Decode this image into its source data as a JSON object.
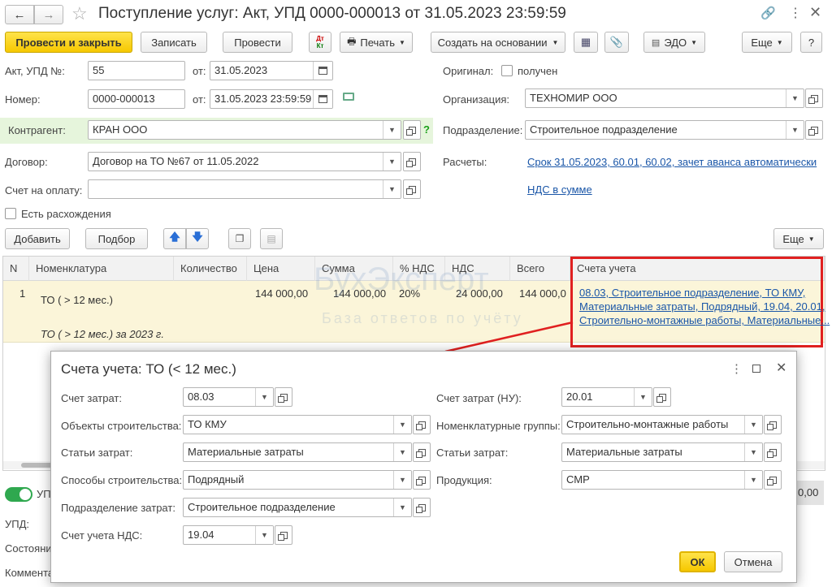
{
  "window": {
    "title": "Поступление услуг: Акт, УПД 0000-000013 от 31.05.2023 23:59:59"
  },
  "toolbar": {
    "post_close": "Провести и закрыть",
    "save": "Записать",
    "post": "Провести",
    "dtkt_top": "Дт",
    "dtkt_bottom": "Кт",
    "print": "Печать",
    "create_based": "Создать на основании",
    "edo": "ЭДО",
    "more": "Еще",
    "help": "?"
  },
  "form": {
    "act_label": "Акт, УПД №:",
    "act_value": "55",
    "from_label": "от:",
    "act_date": "31.05.2023",
    "number_label": "Номер:",
    "number_value": "0000-000013",
    "number_date": "31.05.2023 23:59:59",
    "contractor_label": "Контрагент:",
    "contractor_value": "КРАН ООО",
    "contract_label": "Договор:",
    "contract_value": "Договор на ТО №67 от 11.05.2022",
    "invoice_label": "Счет на оплату:",
    "invoice_value": "",
    "discrepancy_label": "Есть расхождения",
    "original_label": "Оригинал:",
    "received_label": "получен",
    "org_label": "Организация:",
    "org_value": "ТЕХНОМИР ООО",
    "dept_label": "Подразделение:",
    "dept_value": "Строительное подразделение",
    "settlements_label": "Расчеты:",
    "settlements_link": "Срок 31.05.2023, 60.01, 60.02, зачет аванса автоматически",
    "vat_link": "НДС в сумме"
  },
  "table_toolbar": {
    "add": "Добавить",
    "pick": "Подбор",
    "more": "Еще"
  },
  "table": {
    "columns": [
      "N",
      "Номенклатура",
      "Количество",
      "Цена",
      "Сумма",
      "% НДС",
      "НДС",
      "Всего",
      "Счета учета"
    ],
    "row": {
      "n": "1",
      "item": "ТО ( > 12 мес.)",
      "item_sub": "ТО ( > 12 мес.) за 2023 г.",
      "price": "144 000,00",
      "sum": "144 000,00",
      "vat_rate": "20%",
      "vat": "24 000,00",
      "total": "144 000,0",
      "accounts_1": "08.03, Строительное подразделение, ТО КМУ,",
      "accounts_2": "Материальные затраты, Подрядный, 19.04, 20.01,",
      "accounts_3": "Строительно-монтажные работы, Материальные..."
    }
  },
  "bottom": {
    "toggle_label": "УП",
    "upd_label": "УПД:",
    "state_label": "Состояни",
    "comment_label": "Коммента",
    "total_fragment": "0,00"
  },
  "watermark": {
    "brand": "БухЭксперт",
    "tagline": "База ответов по учёту"
  },
  "dialog": {
    "title": "Счета учета: ТО (< 12 мес.)",
    "cost_account_label": "Счет затрат:",
    "cost_account_value": "08.03",
    "construction_label": "Объекты строительства:",
    "construction_value": "ТО КМУ",
    "cost_items_label": "Статьи затрат:",
    "cost_items_value": "Материальные затраты",
    "method_label": "Способы строительства:",
    "method_value": "Подрядный",
    "cost_dept_label": "Подразделение затрат:",
    "cost_dept_value": "Строительное подразделение",
    "vat_account_label": "Счет учета НДС:",
    "vat_account_value": "19.04",
    "cost_account_nu_label": "Счет затрат (НУ):",
    "cost_account_nu_value": "20.01",
    "nom_groups_label": "Номенклатурные группы:",
    "nom_groups_value": "Строительно-монтажные работы",
    "cost_items2_label": "Статьи затрат:",
    "cost_items2_value": "Материальные затраты",
    "product_label": "Продукция:",
    "product_value": "СМР",
    "ok": "ОК",
    "cancel": "Отмена"
  }
}
